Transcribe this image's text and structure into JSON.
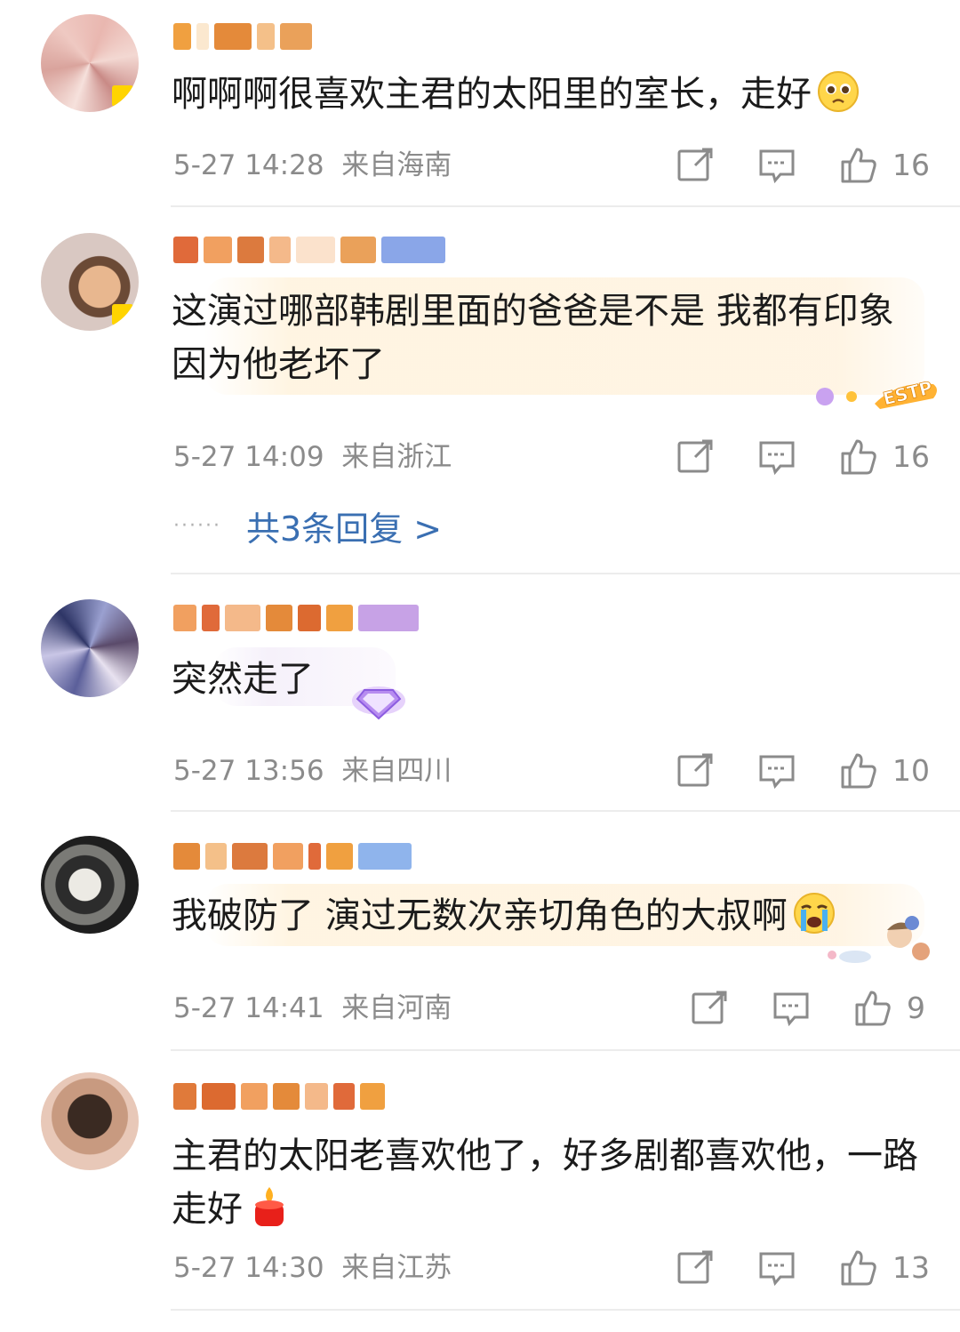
{
  "comments": [
    {
      "text": "啊啊啊很喜欢主君的太阳里的室长，走好",
      "emoji": "pleading-face",
      "time": "5-27 14:28",
      "location": "来自海南",
      "likes": "16"
    },
    {
      "text": "这演过哪部韩剧里面的爸爸是不是 我都有印象 因为他老坏了",
      "time": "5-27 14:09",
      "location": "来自浙江",
      "likes": "16",
      "replies_label": "共3条回复 >",
      "badge": "ESTP"
    },
    {
      "text": "突然走了",
      "time": "5-27 13:56",
      "location": "来自四川",
      "likes": "10"
    },
    {
      "text": "我破防了 演过无数次亲切角色的大叔啊",
      "emoji": "loudly-crying-face",
      "time": "5-27 14:41",
      "location": "来自河南",
      "likes": "9"
    },
    {
      "text": "主君的太阳老喜欢他了，好多剧都喜欢他，一路走好",
      "emoji": "candle",
      "time": "5-27 14:30",
      "location": "来自江苏",
      "likes": "13"
    }
  ],
  "reply_dots": "······",
  "colors": {
    "meta_gray": "#8b8b8b",
    "link_blue": "#3a6fb2",
    "divider": "#ececec",
    "bubble": "#fff4e0"
  },
  "icons": [
    "share-icon",
    "comment-icon",
    "like-icon"
  ]
}
